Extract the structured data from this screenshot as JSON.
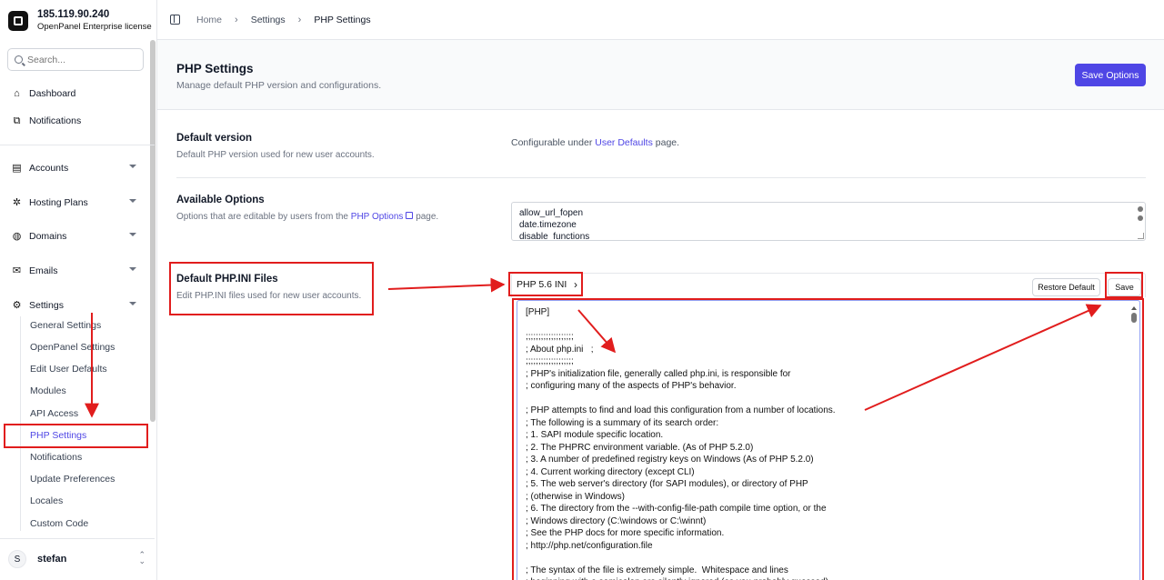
{
  "brand": {
    "ip": "185.119.90.240",
    "license": "OpenPanel Enterprise license"
  },
  "search": {
    "placeholder": "Search..."
  },
  "nav": {
    "dashboard": "Dashboard",
    "notifications": "Notifications",
    "accounts": "Accounts",
    "hosting_plans": "Hosting Plans",
    "domains": "Domains",
    "emails": "Emails",
    "settings": "Settings"
  },
  "settings_sub": [
    "General Settings",
    "OpenPanel Settings",
    "Edit User Defaults",
    "Modules",
    "API Access",
    "PHP Settings",
    "Notifications",
    "Update Preferences",
    "Locales",
    "Custom Code"
  ],
  "user": {
    "initial": "S",
    "name": "stefan"
  },
  "breadcrumb": {
    "home": "Home",
    "settings": "Settings",
    "current": "PHP Settings"
  },
  "page": {
    "title": "PHP Settings",
    "subtitle": "Manage default PHP version and configurations.",
    "save_options": "Save Options"
  },
  "default_version": {
    "title": "Default version",
    "desc": "Default PHP version used for new user accounts.",
    "cfg_prefix": "Configurable under",
    "cfg_link": "User Defaults",
    "cfg_suffix": "page."
  },
  "available_options": {
    "title": "Available Options",
    "desc_prefix": "Options that are editable by users from the",
    "desc_link": "PHP Options",
    "desc_suffix": "page.",
    "items": [
      "allow_url_fopen",
      "date.timezone",
      "disable_functions"
    ]
  },
  "ini_files": {
    "title": "Default PHP.INI Files",
    "desc": "Edit PHP.INI files used for new user accounts.",
    "selected_version": "PHP 5.6 INI",
    "restore_label": "Restore Default",
    "save_label": "Save",
    "content": "[PHP]\n\n;;;;;;;;;;;;;;;;;;;\n; About php.ini   ;\n;;;;;;;;;;;;;;;;;;;\n; PHP's initialization file, generally called php.ini, is responsible for\n; configuring many of the aspects of PHP's behavior.\n\n; PHP attempts to find and load this configuration from a number of locations.\n; The following is a summary of its search order:\n; 1. SAPI module specific location.\n; 2. The PHPRC environment variable. (As of PHP 5.2.0)\n; 3. A number of predefined registry keys on Windows (As of PHP 5.2.0)\n; 4. Current working directory (except CLI)\n; 5. The web server's directory (for SAPI modules), or directory of PHP\n; (otherwise in Windows)\n; 6. The directory from the --with-config-file-path compile time option, or the\n; Windows directory (C:\\windows or C:\\winnt)\n; See the PHP docs for more specific information.\n; http://php.net/configuration.file\n\n; The syntax of the file is extremely simple.  Whitespace and lines\n; beginning with a semicolon are silently ignored (as you probably guessed)."
  },
  "colors": {
    "accent": "#4f46e5",
    "annotation": "#e11d1d"
  }
}
